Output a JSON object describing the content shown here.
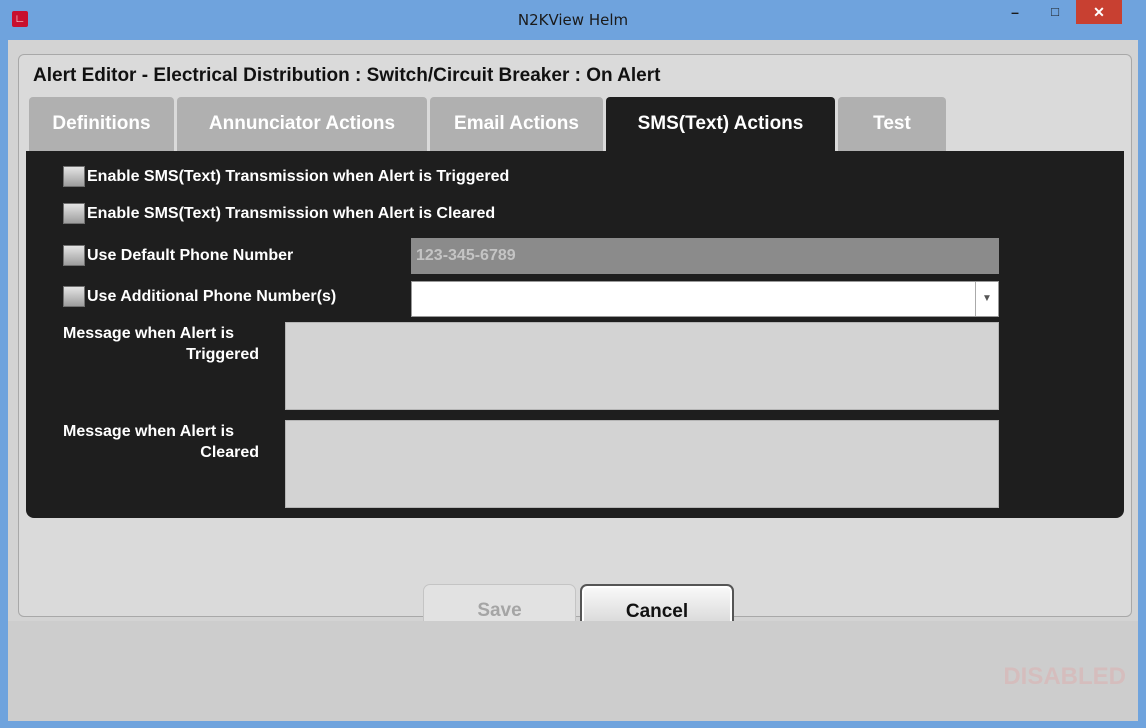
{
  "window": {
    "title": "N2KView Helm",
    "minimize_glyph": "–",
    "maximize_glyph": "□",
    "close_glyph": "✕",
    "app_icon": "app-logo-icon"
  },
  "editor": {
    "title": "Alert Editor - Electrical Distribution : Switch/Circuit Breaker : On Alert"
  },
  "tabs": [
    {
      "label": "Definitions",
      "active": false
    },
    {
      "label": "Annunciator Actions",
      "active": false
    },
    {
      "label": "Email Actions",
      "active": false
    },
    {
      "label": "SMS(Text) Actions",
      "active": true
    },
    {
      "label": "Test",
      "active": false
    }
  ],
  "options": {
    "enable_triggered": {
      "label": "Enable SMS(Text) Transmission when Alert is Triggered",
      "checked": false
    },
    "enable_cleared": {
      "label": "Enable SMS(Text) Transmission when Alert is Cleared",
      "checked": false
    },
    "use_default_phone": {
      "label": "Use Default Phone Number",
      "checked": false,
      "value": "123-345-6789"
    },
    "use_additional_phone": {
      "label": "Use Additional Phone Number(s)",
      "checked": false,
      "value": ""
    }
  },
  "messages": {
    "triggered": {
      "label_line1": "Message when Alert is",
      "label_line2": "Triggered",
      "value": ""
    },
    "cleared": {
      "label_line1": "Message when Alert is",
      "label_line2": "Cleared",
      "value": ""
    }
  },
  "buttons": {
    "save": "Save",
    "cancel": "Cancel"
  },
  "status": {
    "text": "DISABLED"
  },
  "colors": {
    "titlebar": "#6fa3dd",
    "panel": "#1e1e1e",
    "close_button": "#c84031"
  }
}
